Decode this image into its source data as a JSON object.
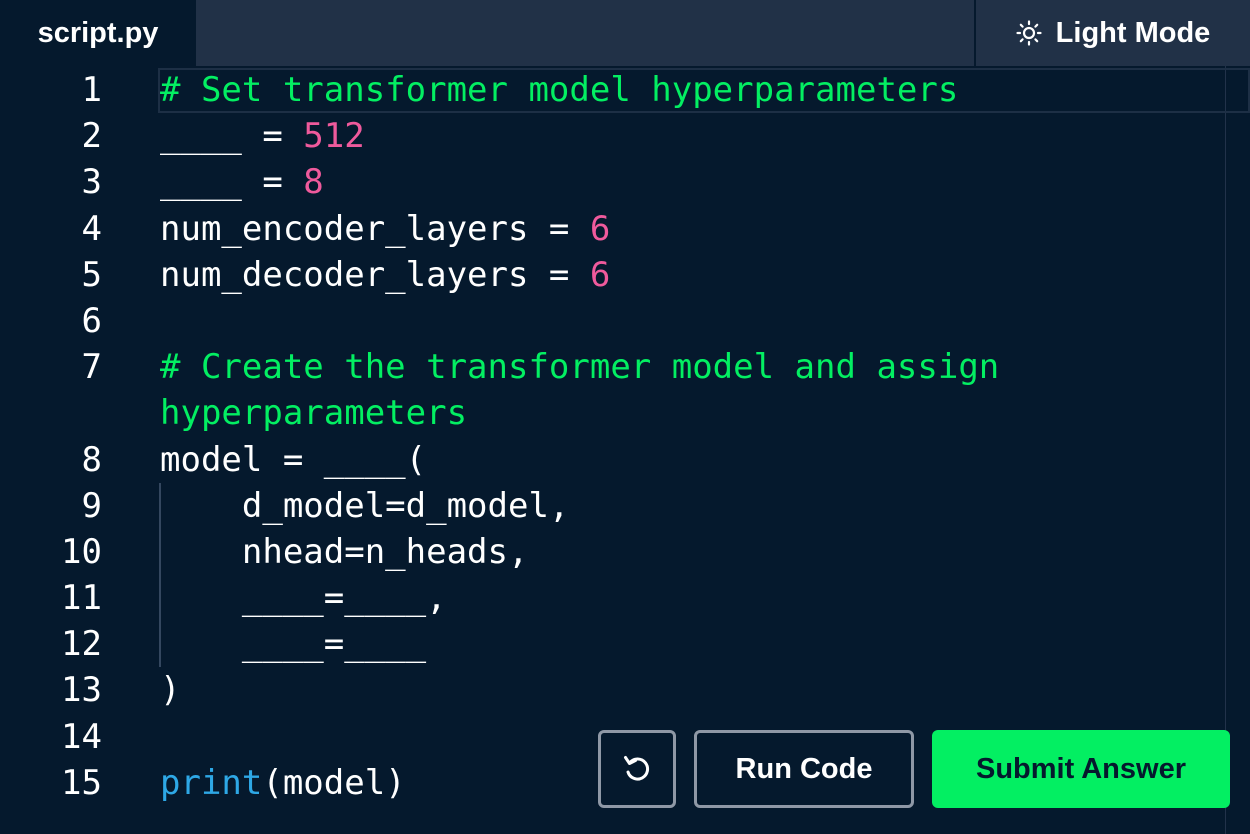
{
  "tabs": {
    "file_tab": "script.py",
    "light_mode_label": "Light Mode"
  },
  "editor": {
    "line_numbers": [
      "1",
      "2",
      "3",
      "4",
      "5",
      "6",
      "7",
      "8",
      "9",
      "10",
      "11",
      "12",
      "13",
      "14",
      "15"
    ],
    "lines": {
      "l1": "# Set transformer model hyperparameters",
      "l2_a": "____ = ",
      "l2_b": "512",
      "l3_a": "____ = ",
      "l3_b": "8",
      "l4_a": "num_encoder_layers = ",
      "l4_b": "6",
      "l5_a": "num_decoder_layers = ",
      "l5_b": "6",
      "l7_a": "# Create the transformer model and assign",
      "l7_b": "hyperparameters",
      "l8": "model = ____(",
      "l9": "    d_model=d_model,",
      "l10": "    nhead=n_heads,",
      "l11": "    ____=____,",
      "l12": "    ____=____",
      "l13": ")",
      "l15_a": "print",
      "l15_b": "(model)"
    }
  },
  "buttons": {
    "reset_icon": "reset-icon",
    "run_label": "Run Code",
    "submit_label": "Submit Answer"
  },
  "colors": {
    "background": "#05192d",
    "tabbar": "#213147",
    "comment": "#03ef62",
    "number": "#ef5a9c",
    "builtin": "#2ea8e6",
    "submit": "#03ef62"
  }
}
